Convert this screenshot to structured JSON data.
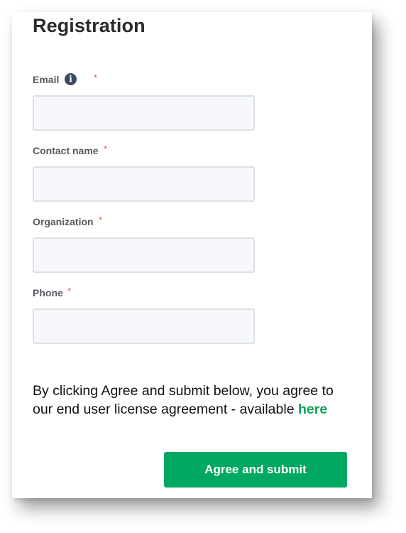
{
  "form": {
    "title": "Registration",
    "required_marker": "*",
    "info_icon_glyph": "i",
    "fields": [
      {
        "label": "Email",
        "value": "",
        "placeholder": "",
        "icon": "info-icon"
      },
      {
        "label": "Contact name",
        "value": "",
        "placeholder": ""
      },
      {
        "label": "Organization",
        "value": "",
        "placeholder": ""
      },
      {
        "label": "Phone",
        "value": "",
        "placeholder": ""
      }
    ],
    "agreement": {
      "text": "By clicking Agree and submit below, you agree to our end user license agreement - available",
      "link_text": "here"
    },
    "submit_label": "Agree and submit"
  },
  "colors": {
    "accent": "#00a862",
    "link": "#14a05a",
    "required": "#e0533a",
    "info_icon": "#3e4a63",
    "input_bg": "#f7f8fb",
    "input_border": "#dde0e6"
  }
}
